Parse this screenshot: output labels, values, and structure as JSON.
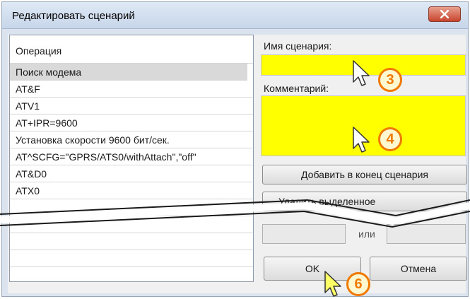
{
  "window": {
    "title": "Редактировать сценарий"
  },
  "list": {
    "header": "Операция",
    "items": [
      "Поиск модема",
      "AT&F",
      "ATV1",
      "AT+IPR=9600",
      "Установка скорости 9600 бит/сек.",
      "AT^SCFG=\"GPRS/ATS0/withAttach\",\"off\"",
      "AT&D0",
      "ATX0"
    ],
    "selected_index": 0
  },
  "form": {
    "name_label": "Имя сценария:",
    "name_value": "",
    "comment_label": "Комментарий:",
    "comment_value": "",
    "add_button": "Добавить в конец сценария",
    "delete_button": "Удалить выделенное",
    "or_label": "или",
    "ok_button": "OK",
    "cancel_button": "Отмена"
  },
  "callouts": [
    "3",
    "4",
    "6"
  ],
  "colors": {
    "highlight": "#ffff00",
    "callout": "#f07a00",
    "close": "#c8452d"
  },
  "icons": [
    "close-icon",
    "arrow-cursor-icon"
  ]
}
